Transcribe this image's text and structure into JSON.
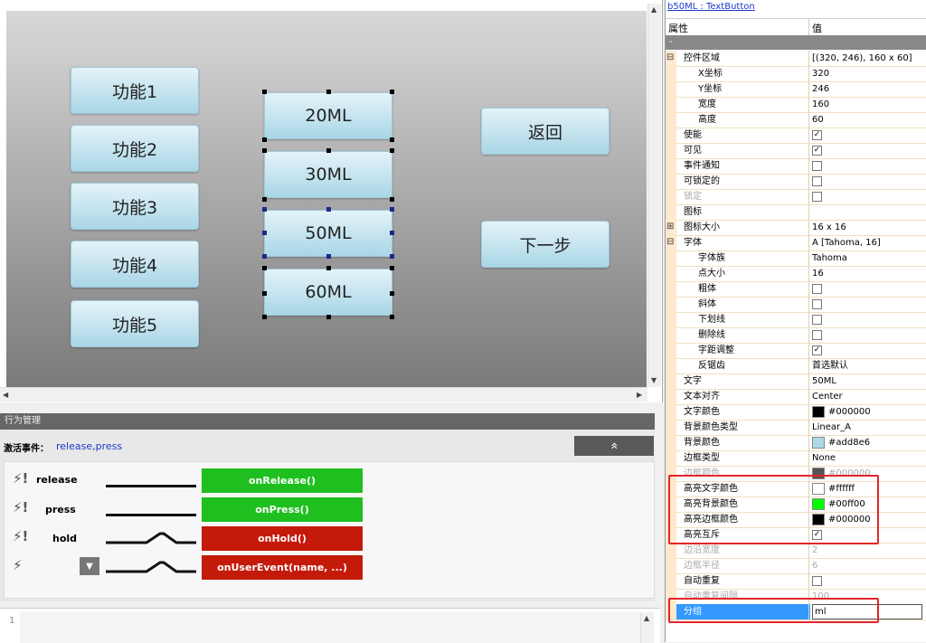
{
  "canvas": {
    "left_buttons": [
      "功能1",
      "功能2",
      "功能3",
      "功能4",
      "功能5"
    ],
    "mid_buttons": [
      "20ML",
      "30ML",
      "50ML",
      "60ML"
    ],
    "right_buttons": [
      "返回",
      "下一步"
    ]
  },
  "behavior": {
    "title": "行为管理",
    "active_label": "激活事件：",
    "active_value": "release,press",
    "collapse_glyph": "»",
    "events": [
      {
        "name": "release",
        "handler": "onRelease()",
        "color": "#1fbf1f"
      },
      {
        "name": "press",
        "handler": "onPress()",
        "color": "#1fbf1f"
      },
      {
        "name": "hold",
        "handler": "onHold()",
        "color": "#c41a0a"
      },
      {
        "name": "",
        "handler": "onUserEvent(name, ...)",
        "color": "#c41a0a"
      }
    ],
    "bolt_glyph": "⚡!",
    "bolt_plain": "⚡",
    "dropdown_glyph": "▼"
  },
  "code": {
    "line_number": "1"
  },
  "props": {
    "title": "b50ML : TextButton",
    "col_name": "属性",
    "col_value": "值",
    "category": "-",
    "rows": [
      {
        "name": "控件区域",
        "value": "[(320, 246), 160 x 60]",
        "indent": 0,
        "expand": "⊟"
      },
      {
        "name": "X坐标",
        "value": "320",
        "indent": 2
      },
      {
        "name": "Y坐标",
        "value": "246",
        "indent": 2
      },
      {
        "name": "宽度",
        "value": "160",
        "indent": 2
      },
      {
        "name": "高度",
        "value": "60",
        "indent": 2
      },
      {
        "name": "使能",
        "value": "",
        "check": "✓",
        "indent": 1
      },
      {
        "name": "可见",
        "value": "",
        "check": "✓",
        "indent": 1
      },
      {
        "name": "事件通知",
        "value": "",
        "check": "",
        "indent": 1
      },
      {
        "name": "可锁定的",
        "value": "",
        "check": "",
        "indent": 1
      },
      {
        "name": "锁定",
        "value": "",
        "check": "",
        "indent": 1,
        "dim": true
      },
      {
        "name": "图标",
        "value": "",
        "indent": 1
      },
      {
        "name": "图标大小",
        "value": "16 x 16",
        "indent": 0,
        "expand": "⊞"
      },
      {
        "name": "字体",
        "value": "A  [Tahoma, 16]",
        "indent": 0,
        "expand": "⊟"
      },
      {
        "name": "字体族",
        "value": "Tahoma",
        "indent": 2
      },
      {
        "name": "点大小",
        "value": "16",
        "indent": 2
      },
      {
        "name": "粗体",
        "value": "",
        "check": "",
        "indent": 2
      },
      {
        "name": "斜体",
        "value": "",
        "check": "",
        "indent": 2
      },
      {
        "name": "下划线",
        "value": "",
        "check": "",
        "indent": 2
      },
      {
        "name": "删除线",
        "value": "",
        "check": "",
        "indent": 2
      },
      {
        "name": "字距调整",
        "value": "",
        "check": "✓",
        "indent": 2
      },
      {
        "name": "反锯齿",
        "value": "首选默认",
        "indent": 2
      },
      {
        "name": "文字",
        "value": "50ML",
        "indent": 1
      },
      {
        "name": "文本对齐",
        "value": "Center",
        "indent": 1
      },
      {
        "name": "文字颜色",
        "value": "#000000",
        "swatch": "#000000",
        "indent": 1
      },
      {
        "name": "背景颜色类型",
        "value": "Linear_A",
        "indent": 1
      },
      {
        "name": "背景颜色",
        "value": "#add8e6",
        "swatch": "#add8e6",
        "indent": 1
      },
      {
        "name": "边框类型",
        "value": "None",
        "indent": 1
      },
      {
        "name": "边框颜色",
        "value": "#000000",
        "swatch": "#555555",
        "indent": 1,
        "dim": true
      },
      {
        "name": "高亮文字颜色",
        "value": "#ffffff",
        "swatch": "#ffffff",
        "indent": 1
      },
      {
        "name": "高亮背景颜色",
        "value": "#00ff00",
        "swatch": "#00ff00",
        "indent": 1
      },
      {
        "name": "高亮边框颜色",
        "value": "#000000",
        "swatch": "#000000",
        "indent": 1
      },
      {
        "name": "高亮互斥",
        "value": "",
        "check": "✓",
        "indent": 1
      },
      {
        "name": "边沿宽度",
        "value": "2",
        "indent": 1,
        "dim": true
      },
      {
        "name": "边框半径",
        "value": "6",
        "indent": 1,
        "dim": true
      },
      {
        "name": "自动重复",
        "value": "",
        "check": "",
        "indent": 1
      },
      {
        "name": "自动重复间隔",
        "value": "100",
        "indent": 1,
        "dim": true
      },
      {
        "name": "分组",
        "value": "ml",
        "indent": 1,
        "selected": true
      }
    ]
  }
}
